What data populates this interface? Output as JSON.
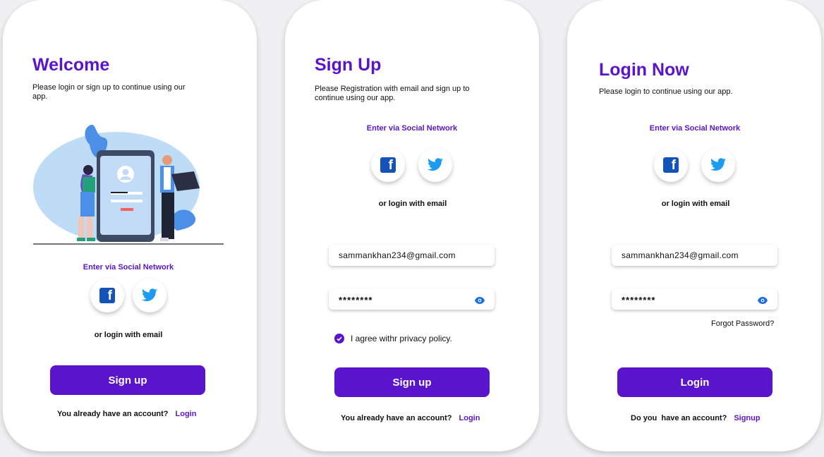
{
  "colors": {
    "primary": "#5a14cc",
    "facebook": "#1453b8",
    "twitter": "#1d9bf0",
    "background": "#f0f0f2"
  },
  "welcome": {
    "title": "Welcome",
    "subtitle": "Please login or sign up to continue using our app.",
    "social_heading": "Enter via Social Network",
    "social_icons": [
      "facebook-icon",
      "twitter-icon"
    ],
    "or_text": "or login with email",
    "primary_button": "Sign up",
    "footer_text": "You already have an account?",
    "footer_link": "Login"
  },
  "signup": {
    "title": "Sign Up",
    "subtitle": "Please Registration with email and sign up to continue using our app.",
    "social_heading": "Enter via Social Network",
    "social_icons": [
      "facebook-icon",
      "twitter-icon"
    ],
    "or_text": "or login with email",
    "email_value": "sammankhan234@gmail.com",
    "password_value": "********",
    "agree_text": "I agree withr privacy policy.",
    "agree_checked": true,
    "primary_button": "Sign up",
    "footer_text": "You already have an account?",
    "footer_link": "Login"
  },
  "login": {
    "title": "Login Now",
    "subtitle": "Please login to continue using our app.",
    "social_heading": "Enter via Social Network",
    "social_icons": [
      "facebook-icon",
      "twitter-icon"
    ],
    "or_text": "or login with email",
    "email_value": "sammankhan234@gmail.com",
    "password_value": "********",
    "forgot_link": "Forgot Password?",
    "primary_button": "Login",
    "footer_text": "Do you  have an account?",
    "footer_link": "Signup"
  }
}
